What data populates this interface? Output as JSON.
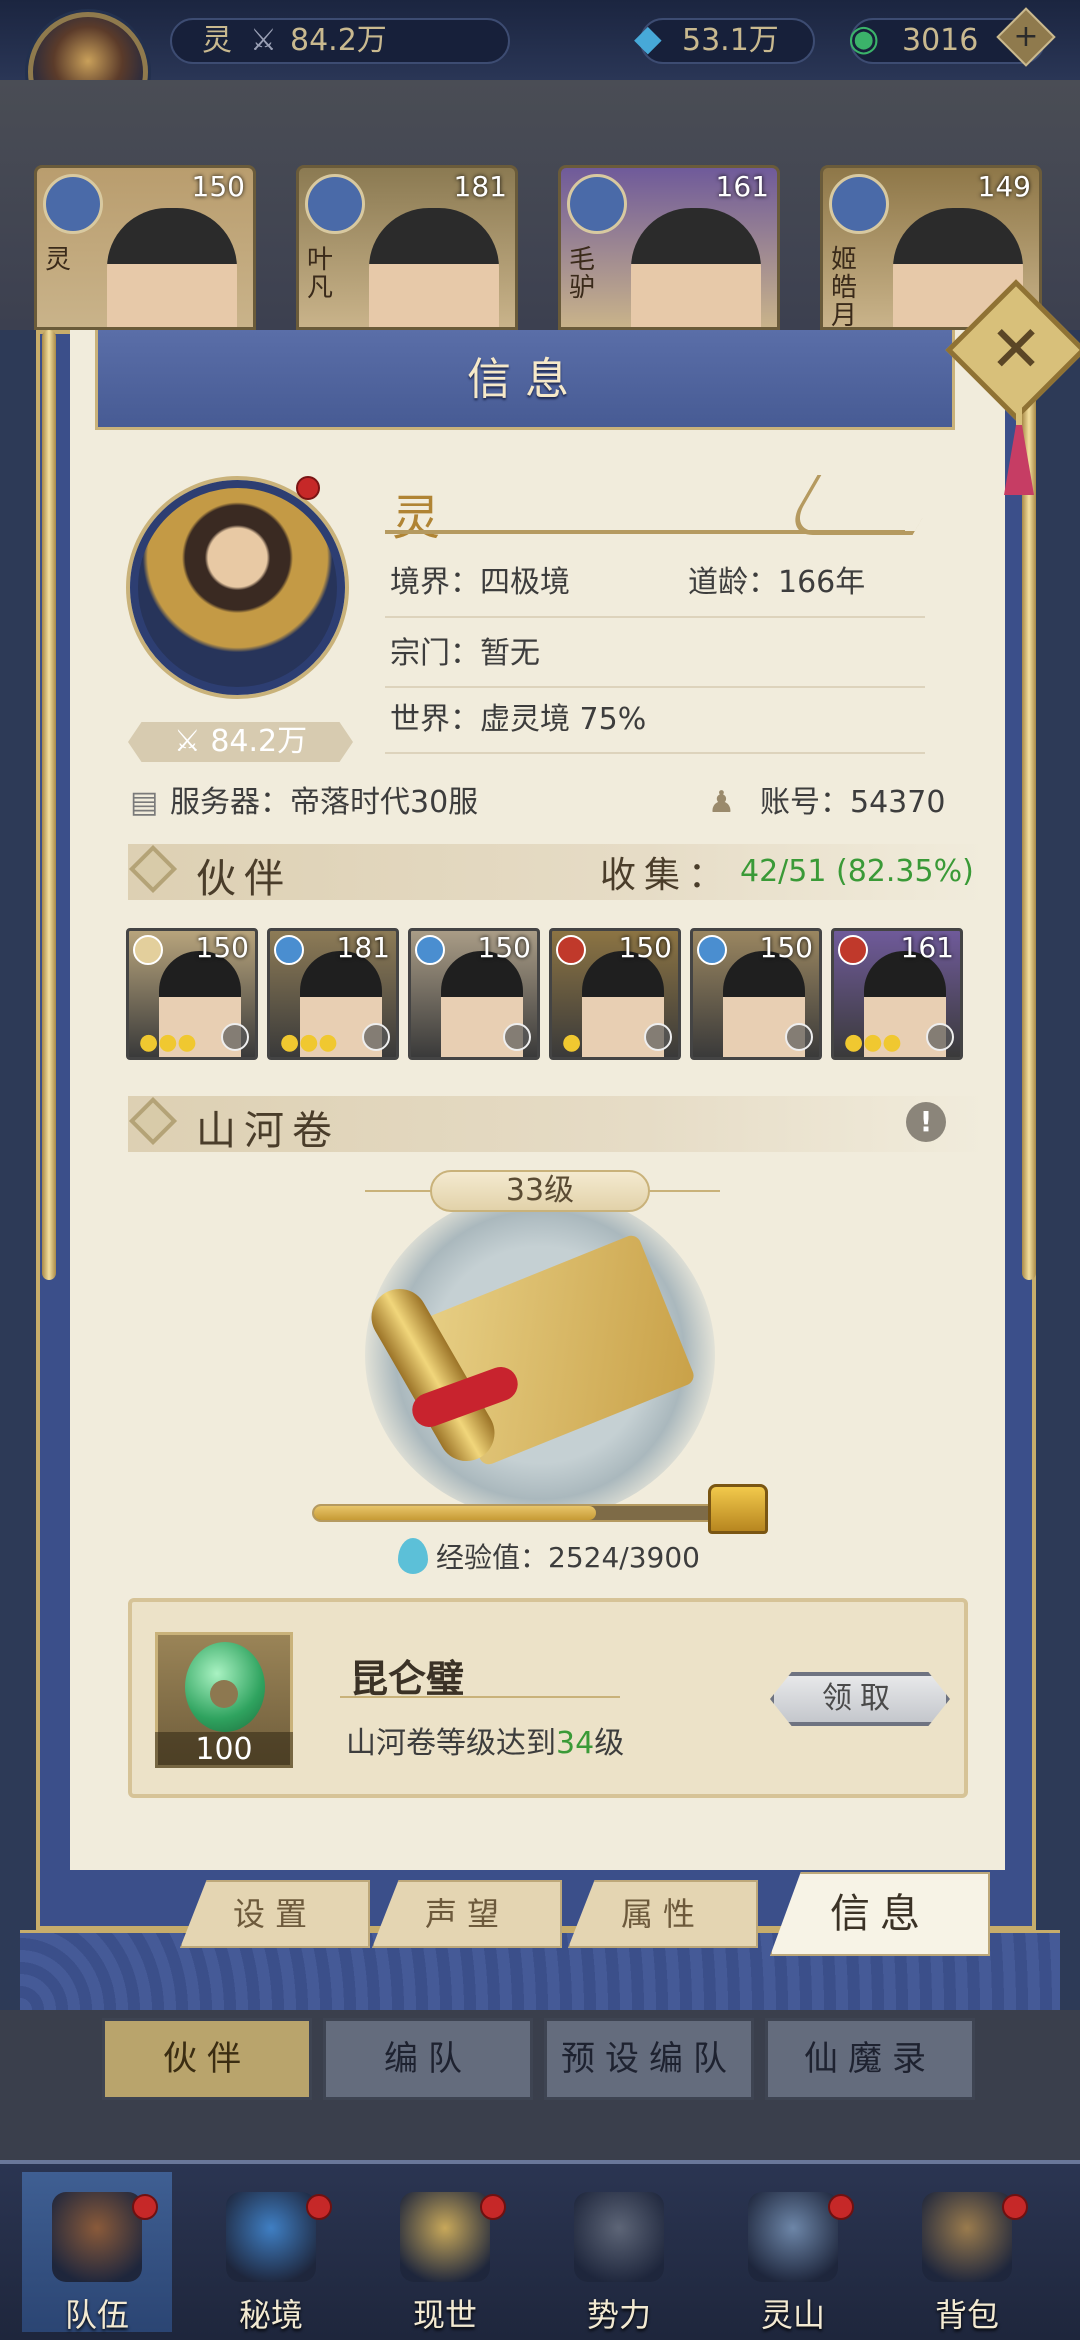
{
  "topbar": {
    "player_name": "灵",
    "power": "84.2万",
    "spirit_stones": "53.1万",
    "jade_currency": "3016"
  },
  "team_strip": [
    {
      "name": "灵",
      "level": "150",
      "element": "light",
      "color": "#b99d6e"
    },
    {
      "name": "叶凡",
      "level": "181",
      "element": "water",
      "color": "#8b7a52"
    },
    {
      "name": "毛驴",
      "level": "161",
      "element": "fire",
      "color": "#6f5a9a"
    },
    {
      "name": "姬皓月",
      "level": "149",
      "element": "wind",
      "color": "#8e7748"
    }
  ],
  "panel": {
    "title": "信息",
    "close_label": "✕",
    "name": "灵",
    "power": "84.2万",
    "realm_label": "境界：四极境",
    "dao_age_label": "道龄：166年",
    "sect_label": "宗门：暂无",
    "world_label": "世界：虚灵境  75%",
    "server_label": "服务器：帝落时代30服",
    "account_label": "账号：54370"
  },
  "partners": {
    "title": "伙伴",
    "collect_label": "收集：",
    "collect_value": "42/51 (82.35%)",
    "collect_color": "#3a9a37",
    "list": [
      {
        "level": "150",
        "stars": "●●●",
        "elem_color": "#e3cf9c",
        "bg": "#b8a47c"
      },
      {
        "level": "181",
        "stars": "●●●",
        "elem_color": "#4a8ed0",
        "bg": "#8d7b56"
      },
      {
        "level": "150",
        "stars": "",
        "elem_color": "#4a8ed0",
        "bg": "#a99c86"
      },
      {
        "level": "150",
        "stars": "●",
        "elem_color": "#c0392b",
        "bg": "#8c7443"
      },
      {
        "level": "150",
        "stars": "",
        "elem_color": "#4a8ed0",
        "bg": "#9a8660"
      },
      {
        "level": "161",
        "stars": "●●●",
        "elem_color": "#c0392b",
        "bg": "#6f5a9a"
      }
    ]
  },
  "scroll": {
    "title": "山河卷",
    "info_icon": "!",
    "level_label": "33级",
    "exp_label": "经验值：",
    "exp_value": "2524/3900",
    "exp_progress": 0.647
  },
  "reward": {
    "item_name": "昆仑璧",
    "item_count": "100",
    "condition_prefix": "山河卷等级达到",
    "condition_level": "34",
    "condition_suffix": "级",
    "claim_label": "领取"
  },
  "panel_tabs": [
    "设置",
    "声望",
    "属性",
    "信息"
  ],
  "team_tabs": [
    "伙伴",
    "编队",
    "预设编队",
    "仙魔录"
  ],
  "bottom_nav": [
    {
      "label": "队伍",
      "icon": "team-icon",
      "color": "#8a5a3a"
    },
    {
      "label": "秘境",
      "icon": "portal-icon",
      "color": "#3f7fc4"
    },
    {
      "label": "现世",
      "icon": "scroll-icon",
      "color": "#c8a85a"
    },
    {
      "label": "势力",
      "icon": "palace-icon",
      "color": "#5d6577"
    },
    {
      "label": "灵山",
      "icon": "mountain-icon",
      "color": "#6d86a8"
    },
    {
      "label": "背包",
      "icon": "bag-icon",
      "color": "#9a7b4d"
    }
  ]
}
